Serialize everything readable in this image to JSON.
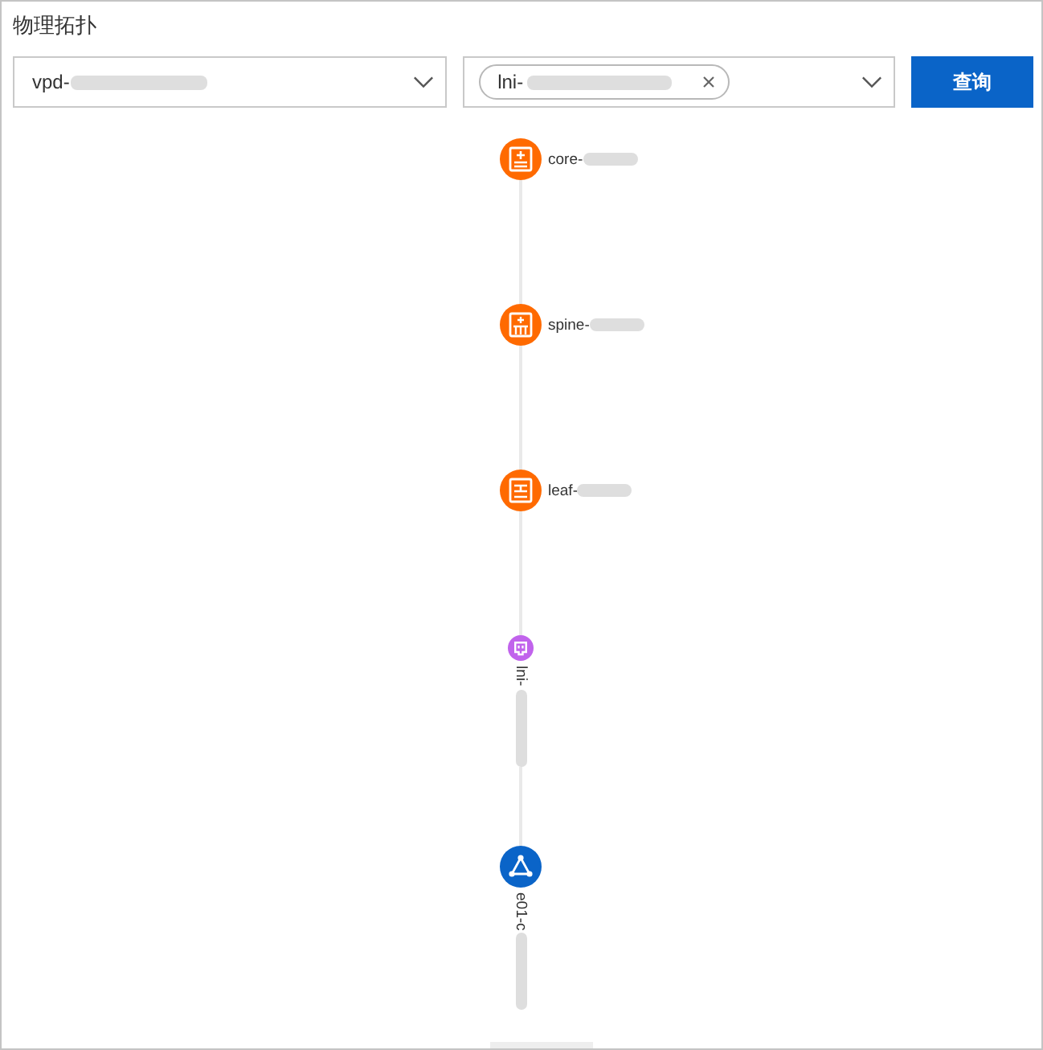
{
  "title": "物理拓扑",
  "filters": {
    "network_select": {
      "value": "vpd-",
      "redacted": true
    },
    "instance_select": {
      "tags": [
        {
          "label": "lni-",
          "redacted": true
        }
      ]
    },
    "query_button": "查询"
  },
  "topology": {
    "nodes": [
      {
        "kind": "core",
        "label": "core-",
        "redacted": true,
        "color": "#ff6a00"
      },
      {
        "kind": "spine",
        "label": "spine-",
        "redacted": true,
        "color": "#ff6a00"
      },
      {
        "kind": "leaf",
        "label": "leaf-",
        "redacted": true,
        "color": "#ff6a00"
      },
      {
        "kind": "port",
        "label": "lni-",
        "redacted": true,
        "color": "#c163ec"
      },
      {
        "kind": "cluster",
        "label": "e01-c",
        "redacted": true,
        "color": "#0a64c8"
      }
    ]
  }
}
